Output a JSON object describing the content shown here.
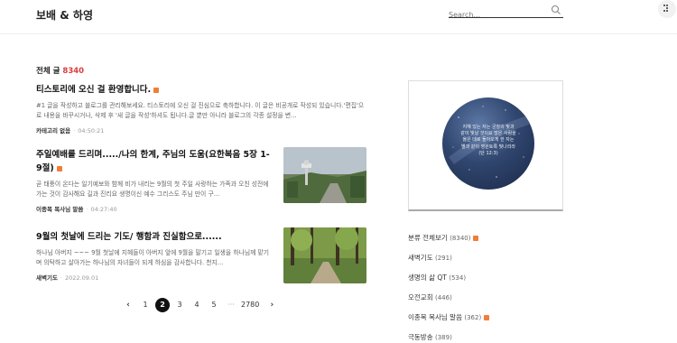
{
  "header": {
    "blog_title": "보배 & 하영",
    "search_placeholder": "Search..."
  },
  "posts_header": {
    "label": "전체 글",
    "count": "8340"
  },
  "posts": [
    {
      "title": "티스토리에 오신 걸 환영합니다.",
      "excerpt": "#1 글을 작성하고 블로그를 관리해보세요. 티스토리에 오신 걸 진심으로 축하합니다. 이 글은 비공개로 작성되 있습니다.'편집'으로 내용을 바꾸시거나, 삭제 후 '새 글을 작성'하셔도 됩니다.글 뿐만 아니라 블로그의 각종 설정을 변...",
      "category": "카테고리 없음",
      "date": "04:50:21"
    },
    {
      "title": "주일예배를 드리며...../나의 한계, 주님의 도움(요한복음 5장 1-9절)",
      "excerpt": "곧 태풍이 온다는 일기예보와 함께 비가 내리는 9월의 첫 주일 사랑하는 가족과 오친 성전에 가는 것이 감사해요 길과 진리요 생명이신 예수 그리스도 주님 만이 구...",
      "category": "이종목 목사님 말씀",
      "date": "04:27:40"
    },
    {
      "title": "9월의 첫날에 드리는 기도/ 행함과 진실함으로......",
      "excerpt": "하나님 아버지 ~~~ 9월 첫날에 지혜들이 아버지 앞에 9월을 말기고 일생을 하나님께 맡기며 의탁하고 살아가는 하나님의 자녀들이 되게 하심을 감사합니다. 천지...",
      "category": "새벽기도",
      "date": "2022.09.01"
    }
  ],
  "pagination": {
    "prev": "‹",
    "pages": [
      "1",
      "2",
      "3",
      "4",
      "5"
    ],
    "ellipsis": "···",
    "last": "2780",
    "next": "›",
    "current": "2"
  },
  "sidebar": {
    "verse": [
      "지혜 있는 자는 궁창의 빛과",
      "같이 빛날 것이요 많은 사람을",
      "옳은 데로 돌아오게 한 자는",
      "별과 같이 영원토록 빛나리라",
      "(단 12:3)"
    ],
    "categories": [
      {
        "name": "분류 전체보기",
        "count": "(8340)",
        "new": true
      },
      {
        "name": "새벽기도",
        "count": "(291)",
        "new": false
      },
      {
        "name": "생명의 삶 QT",
        "count": "(534)",
        "new": false
      },
      {
        "name": "오전교회",
        "count": "(446)",
        "new": false
      },
      {
        "name": "이종목 목사님 말씀",
        "count": "(362)",
        "new": true
      },
      {
        "name": "극동방송",
        "count": "(389)",
        "new": false
      }
    ]
  },
  "colors": {
    "accent": "#d93d3d",
    "new_badge": "#f07d3a"
  }
}
